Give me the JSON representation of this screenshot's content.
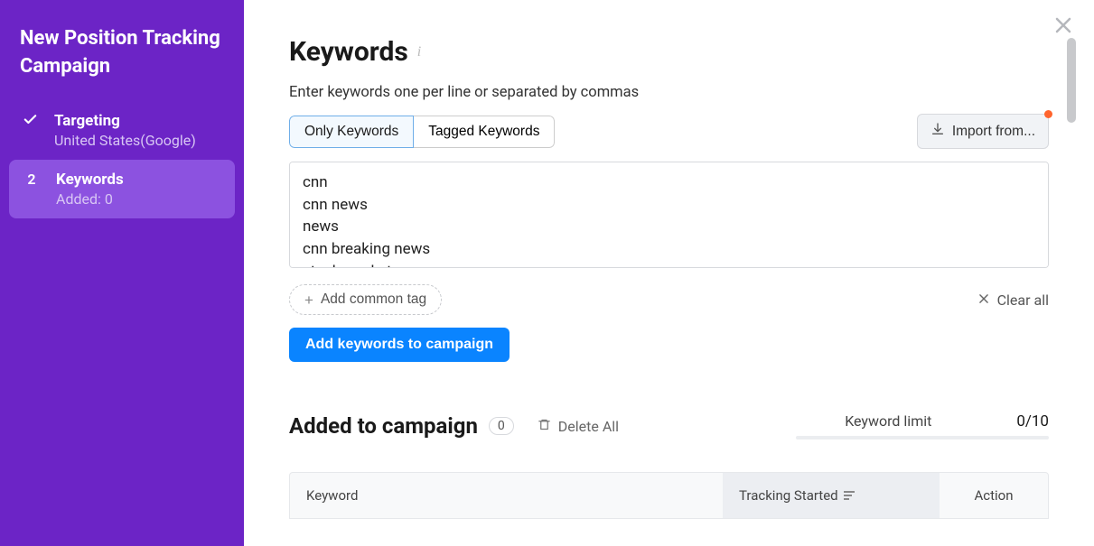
{
  "sidebar": {
    "title": "New Position Tracking Campaign",
    "steps": [
      {
        "label": "Targeting",
        "sub": "United States(Google)"
      },
      {
        "num": "2",
        "label": "Keywords",
        "sub": "Added: 0"
      }
    ]
  },
  "page": {
    "title": "Keywords",
    "subtitle": "Enter keywords one per line or separated by commas"
  },
  "tabs": {
    "only": "Only Keywords",
    "tagged": "Tagged Keywords"
  },
  "import_label": "Import from...",
  "keywords_text": "cnn\ncnn news\nnews\ncnn breaking news\nstock market",
  "buttons": {
    "add_tag": "Add common tag",
    "clear_all": "Clear all",
    "add_keywords": "Add keywords to campaign",
    "delete_all": "Delete All"
  },
  "added": {
    "title": "Added to campaign",
    "count": "0",
    "limit_label": "Keyword limit",
    "limit_value": "0/10"
  },
  "table": {
    "col_keyword": "Keyword",
    "col_tracking": "Tracking Started",
    "col_action": "Action"
  }
}
